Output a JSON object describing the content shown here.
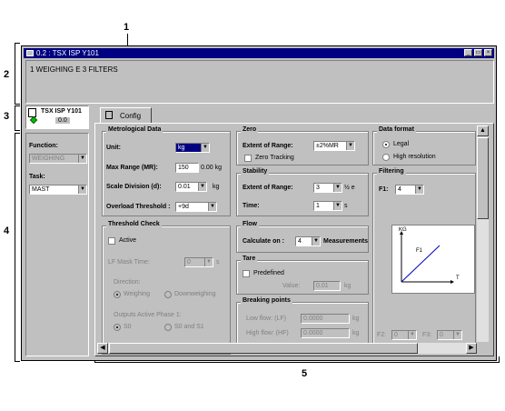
{
  "callouts": {
    "c1": "1",
    "c2": "2",
    "c3": "3",
    "c4": "4",
    "c5": "5"
  },
  "window": {
    "title": "0.2 : TSX ISP Y101",
    "description": "1 WEIGHING E 3 FILTERS",
    "module_name": "TSX ISP Y101",
    "module_slot": "0.0"
  },
  "left_panel": {
    "function_label": "Function:",
    "function_value": "WEIGHING",
    "task_label": "Task:",
    "task_value": "MAST"
  },
  "tab": {
    "label": "Config"
  },
  "metrological": {
    "title": "Metrological Data",
    "unit_label": "Unit:",
    "unit_value": "kg",
    "max_range_label": "Max Range (MR):",
    "max_range_value": "150",
    "max_range_unit": "0.00 kg",
    "scale_div_label": "Scale Division (d):",
    "scale_div_value": "0.01",
    "scale_div_unit": "kg",
    "overload_label": "Overload Threshold :",
    "overload_value": "+9d"
  },
  "zero": {
    "title": "Zero",
    "extent_label": "Extent of Range:",
    "extent_value": "±2%MR",
    "tracking_label": "Zero Tracking"
  },
  "stability": {
    "title": "Stability",
    "extent_label": "Extent of Range:",
    "extent_value": "3",
    "extent_unit": "½ e",
    "time_label": "Time:",
    "time_value": "1",
    "time_unit": "s"
  },
  "threshold": {
    "title": "Threshold Check",
    "active_label": "Active",
    "lf_mask_label": "LF Mask Time:",
    "lf_mask_value": "0",
    "lf_mask_unit": "s",
    "direction_label": "Direction:",
    "weighing_label": "Weighing",
    "downweighing_label": "Downweighing",
    "outputs_label": "Outputs Active Phase 1:",
    "s0_label": "S0",
    "s0s1_label": "S0 and S1"
  },
  "flow": {
    "title": "Flow",
    "calculate_label": "Calculate on :",
    "calculate_value": "4",
    "measurements_label": "Measurements"
  },
  "tare": {
    "title": "Tare",
    "predefined_label": "Predefined",
    "value_label": "Value:",
    "value_value": "0.01",
    "value_unit": "kg"
  },
  "breaking": {
    "title": "Breaking points",
    "low_label": "Low flow: (LF)",
    "low_value": "0.0000",
    "low_unit": "kg",
    "high_label": "High flow: (HF)",
    "high_value": "0.0000",
    "high_unit": "kg"
  },
  "data_format": {
    "title": "Data format",
    "legal_label": "Legal",
    "high_res_label": "High resolution"
  },
  "filtering": {
    "title": "Filtering",
    "f1_label": "F1:",
    "f1_value": "4",
    "graph_y_label": "KG",
    "graph_x_label": "T",
    "graph_curve_label": "F1",
    "f2_label": "F2:",
    "f2_value": "0",
    "f3_label": "F3:",
    "f3_value": "0"
  },
  "colors": {
    "titlebar": "#000080",
    "status_led": "#00c000",
    "curve": "#0000c0"
  }
}
